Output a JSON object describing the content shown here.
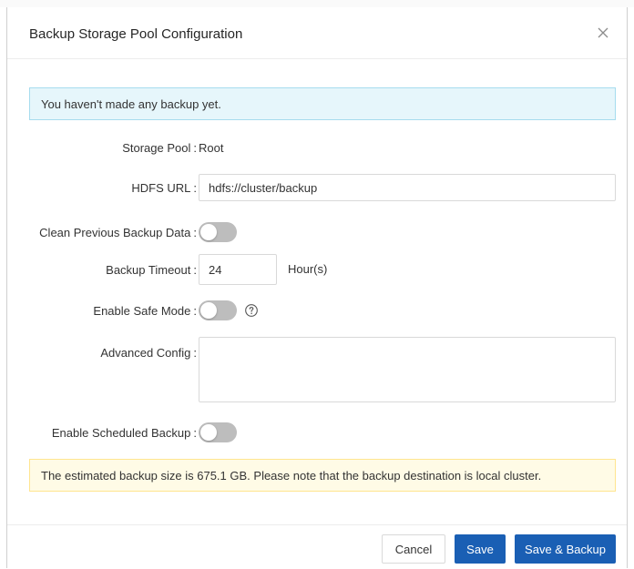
{
  "dialog": {
    "title": "Backup Storage Pool Configuration",
    "close_icon": "close-icon"
  },
  "info_alert": "You haven't made any backup yet.",
  "form": {
    "storage_pool": {
      "label": "Storage Pool",
      "value": "Root"
    },
    "hdfs_url": {
      "label": "HDFS URL",
      "value": "hdfs://cluster/backup"
    },
    "clean_previous": {
      "label": "Clean Previous Backup Data",
      "enabled": false
    },
    "backup_timeout": {
      "label": "Backup Timeout",
      "value": "24",
      "unit": "Hour(s)"
    },
    "safe_mode": {
      "label": "Enable Safe Mode",
      "enabled": false,
      "help_icon": "question-circle-icon"
    },
    "advanced_config": {
      "label": "Advanced Config",
      "value": ""
    },
    "scheduled_backup": {
      "label": "Enable Scheduled Backup",
      "enabled": false
    }
  },
  "warning_alert": "The estimated backup size is 675.1 GB. Please note that the backup destination is local cluster.",
  "footer": {
    "cancel_label": "Cancel",
    "save_label": "Save",
    "save_backup_label": "Save & Backup"
  },
  "colors": {
    "primary": "#1a5fb4",
    "info_bg": "#e6f6fb",
    "info_border": "#a6dcee",
    "warning_bg": "#fffbe6",
    "warning_border": "#ffe58f",
    "switch_off": "#bdbdbd"
  }
}
